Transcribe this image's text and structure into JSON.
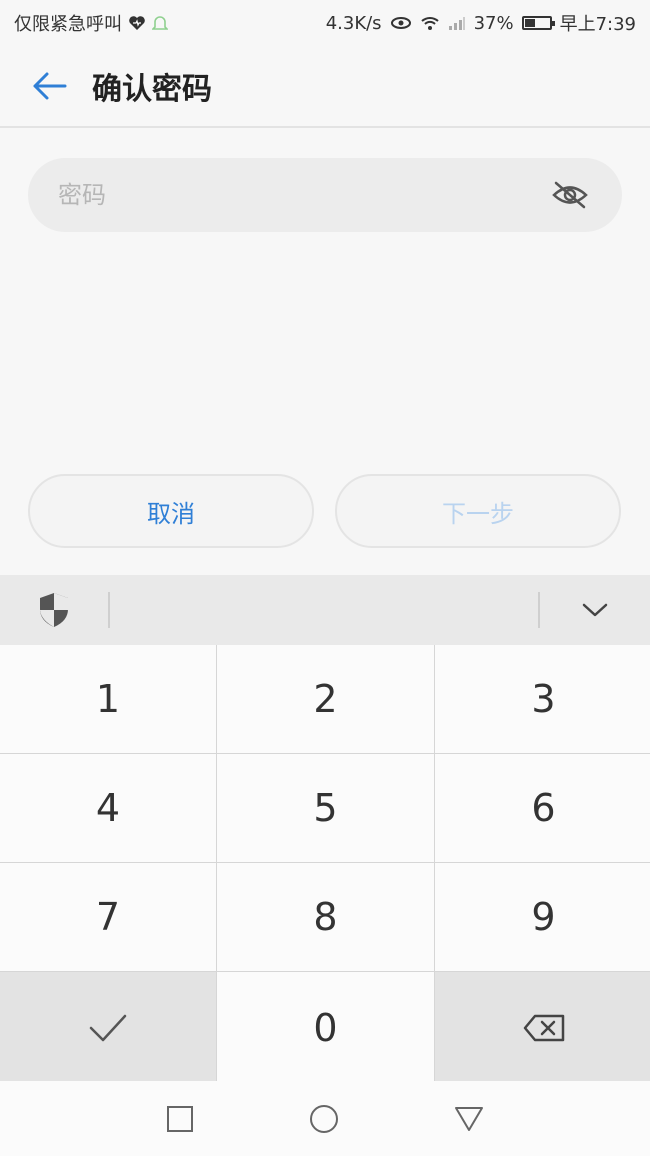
{
  "status_bar": {
    "carrier_text": "仅限紧急呼叫",
    "speed": "4.3K/s",
    "battery": "37%",
    "time": "早上7:39",
    "icons": [
      "heart-icon",
      "bell-icon",
      "eye-icon",
      "wifi-icon",
      "signal-icon",
      "battery-icon"
    ]
  },
  "header": {
    "title": "确认密码",
    "back_icon": "arrow-left-icon",
    "accent": "#2f7fd6"
  },
  "password": {
    "placeholder": "密码",
    "value": "",
    "toggle_icon": "eye-off-icon"
  },
  "actions": {
    "cancel_label": "取消",
    "next_label": "下一步"
  },
  "keyboard": {
    "toolbar": {
      "shield_icon": "shield-icon",
      "collapse_icon": "chevron-down-icon"
    },
    "keys": [
      "1",
      "2",
      "3",
      "4",
      "5",
      "6",
      "7",
      "8",
      "9"
    ],
    "zero": "0",
    "confirm_icon": "check-icon",
    "delete_icon": "backspace-icon"
  },
  "navbar": {
    "icons": [
      "recent-apps-icon",
      "home-icon",
      "back-triangle-icon"
    ]
  }
}
